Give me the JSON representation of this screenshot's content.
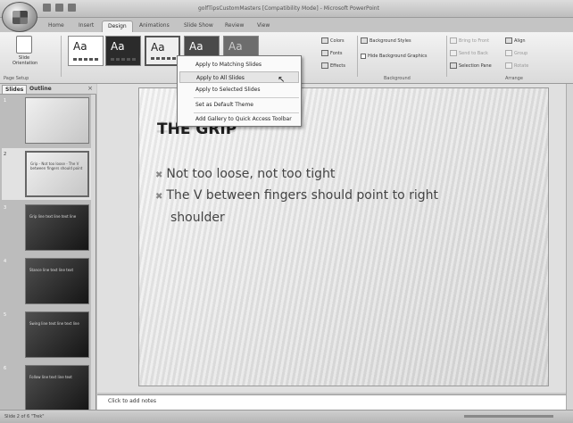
{
  "window": {
    "title": "golfTipsCustomMasters [Compatibility Mode] - Microsoft PowerPoint"
  },
  "ribbon_tabs": [
    "Home",
    "Insert",
    "Design",
    "Animations",
    "Slide Show",
    "Review",
    "View"
  ],
  "active_tab": "Design",
  "ribbon": {
    "page_setup": {
      "orientation_label": "Slide Orientation",
      "group_label": "Page Setup"
    },
    "themes": [
      {
        "label": "Aa"
      },
      {
        "label": "Aa"
      },
      {
        "label": "Aa"
      },
      {
        "label": "Aa"
      },
      {
        "label": "Aa"
      }
    ],
    "theme_commands": {
      "colors": "Colors",
      "fonts": "Fonts",
      "effects": "Effects"
    },
    "background": {
      "styles": "Background Styles",
      "hide": "Hide Background Graphics",
      "group_label": "Background"
    },
    "arrange": {
      "bring_front": "Bring to Front",
      "send_back": "Send to Back",
      "selection_pane": "Selection Pane",
      "align": "Align",
      "group": "Group",
      "rotate": "Rotate",
      "group_label": "Arrange"
    }
  },
  "theme_menu": {
    "items": [
      "Apply to Matching Slides",
      "Apply to All Slides",
      "Apply to Selected Slides",
      "Set as Default Theme",
      "Add Gallery to Quick Access Toolbar"
    ]
  },
  "slides_pane": {
    "tabs": [
      "Slides",
      "Outline"
    ],
    "close": "×",
    "thumbnails": [
      {
        "num": "1",
        "text": ""
      },
      {
        "num": "2",
        "text": "Grip - Not too loose - The V between fingers should point"
      },
      {
        "num": "3",
        "text": "Grip line text line text line"
      },
      {
        "num": "4",
        "text": "Stance line text line text"
      },
      {
        "num": "5",
        "text": "Swing line text line text line"
      },
      {
        "num": "6",
        "text": "Follow line text line text"
      }
    ]
  },
  "slide": {
    "title": "THE GRIP",
    "bullets": [
      "Not too loose, not too tight",
      "The V between fingers should point to right",
      "shoulder"
    ]
  },
  "notes": {
    "placeholder": "Click to add notes"
  },
  "status": {
    "text": "Slide 2 of 6  \"Trek\""
  }
}
